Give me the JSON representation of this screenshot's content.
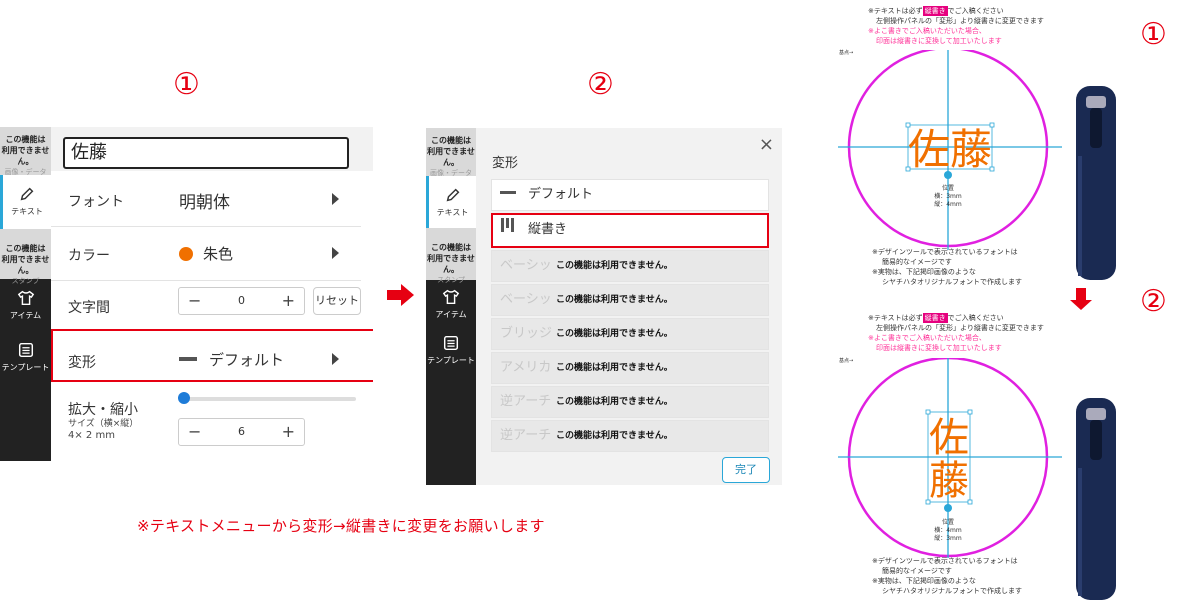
{
  "steps": {
    "step1": "①",
    "step2": "②"
  },
  "panel1": {
    "sidebar": {
      "blocked_top": "この機能は\n利用できません。",
      "blocked_top_ghost": "画像・データ",
      "text_tab": "テキスト",
      "blocked_mid": "この機能は\n利用できません。",
      "blocked_mid_ghost": "スタンプ",
      "item_tab": "アイテム",
      "template_tab": "テンプレート"
    },
    "name_value": "佐藤",
    "font_label": "フォント",
    "font_value": "明朝体",
    "color_label": "カラー",
    "color_value": "朱色",
    "color_swatch": "#f07000",
    "spacing_label": "文字間",
    "spacing_value": "0",
    "reset_label": "リセット",
    "transform_label": "変形",
    "transform_value": "デフォルト",
    "scale_label": "拡大・縮小",
    "size_line1": "サイズ（横×縦）",
    "size_line2": "4× 2 mm",
    "size_value": "6",
    "scale_slider_level": 0.0
  },
  "panel2": {
    "title": "変形",
    "close": "×",
    "options": [
      {
        "label": "デフォルト",
        "state": "normal"
      },
      {
        "label": "縦書き",
        "state": "selected"
      },
      {
        "label": "ベーシッ",
        "state": "disabled",
        "msg": "この機能は利用できません。"
      },
      {
        "label": "ベーシッ",
        "state": "disabled",
        "msg": "この機能は利用できません。"
      },
      {
        "label": "ブリッジ",
        "state": "disabled",
        "msg": "この機能は利用できません。"
      },
      {
        "label": "アメリカ",
        "state": "disabled",
        "msg": "この機能は利用できません。"
      },
      {
        "label": "逆アーチ",
        "state": "disabled",
        "msg": "この機能は利用できません。"
      },
      {
        "label": "逆アーチ",
        "state": "disabled",
        "msg": "この機能は利用できません。"
      }
    ],
    "done_label": "完了"
  },
  "caption": "※テキストメニューから変形→縦書きに変更をお願いします",
  "preview": {
    "instr_line1a": "※テキストは必ず",
    "instr_highlight": "縦書き",
    "instr_line1b": "でご入稿ください",
    "instr_line2": "左側操作パネルの「変形」より縦書きに変更できます",
    "instr_pink1": "※よこ書きでご入稿いただいた場合、",
    "instr_pink2": "印面は縦書きに変換して加工いたします",
    "origin_label": "基点→",
    "stamp_text": "佐藤",
    "stamp_char1": "佐",
    "stamp_char2": "藤",
    "pos1_title": "位置",
    "pos1_h": "横：3mm",
    "pos1_v": "縦：4mm",
    "pos2_title": "位置",
    "pos2_h": "横：4mm",
    "pos2_v": "縦：3mm",
    "note1": "※デザインツールで表示されているフォントは",
    "note2": "簡易的なイメージです",
    "note3": "※実物は、下記掲印画像のような",
    "note4": "シヤチハタオリジナルフォントで作成します",
    "ring_color": "#e020e0",
    "text_color": "#f07000",
    "guide_color": "#2aa7d8"
  }
}
